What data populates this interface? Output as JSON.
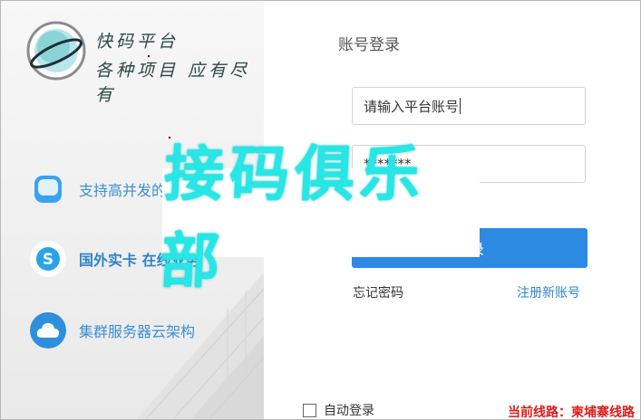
{
  "logo": {
    "line1": "快码平台",
    "line2": "各种项目 应有尽有"
  },
  "features": [
    {
      "icon": "chat-bubble-icon",
      "label": "支持高并发的",
      "color": "#39a3f2"
    },
    {
      "icon": "skype-icon",
      "label": "国外实卡 在线业务",
      "color": "#2aa3e6"
    },
    {
      "icon": "cloud-icon",
      "label": "集群服务器云架构",
      "color": "#2f8fdc"
    }
  ],
  "login": {
    "title": "账号登录",
    "account_placeholder": "请输入平台账号",
    "password_value": "*******",
    "submit_label": "登录",
    "forgot_label": "忘记密码",
    "register_label": "注册新账号",
    "auto_login_label": "自动登录"
  },
  "route": {
    "label": "当前线路：柬埔寨线路"
  },
  "watermark": {
    "text": "接码俱乐部"
  },
  "colors": {
    "accent": "#2d8ae3",
    "link": "#2f84c8",
    "route": "#e01b1b",
    "watermark": "#27e6e6"
  }
}
